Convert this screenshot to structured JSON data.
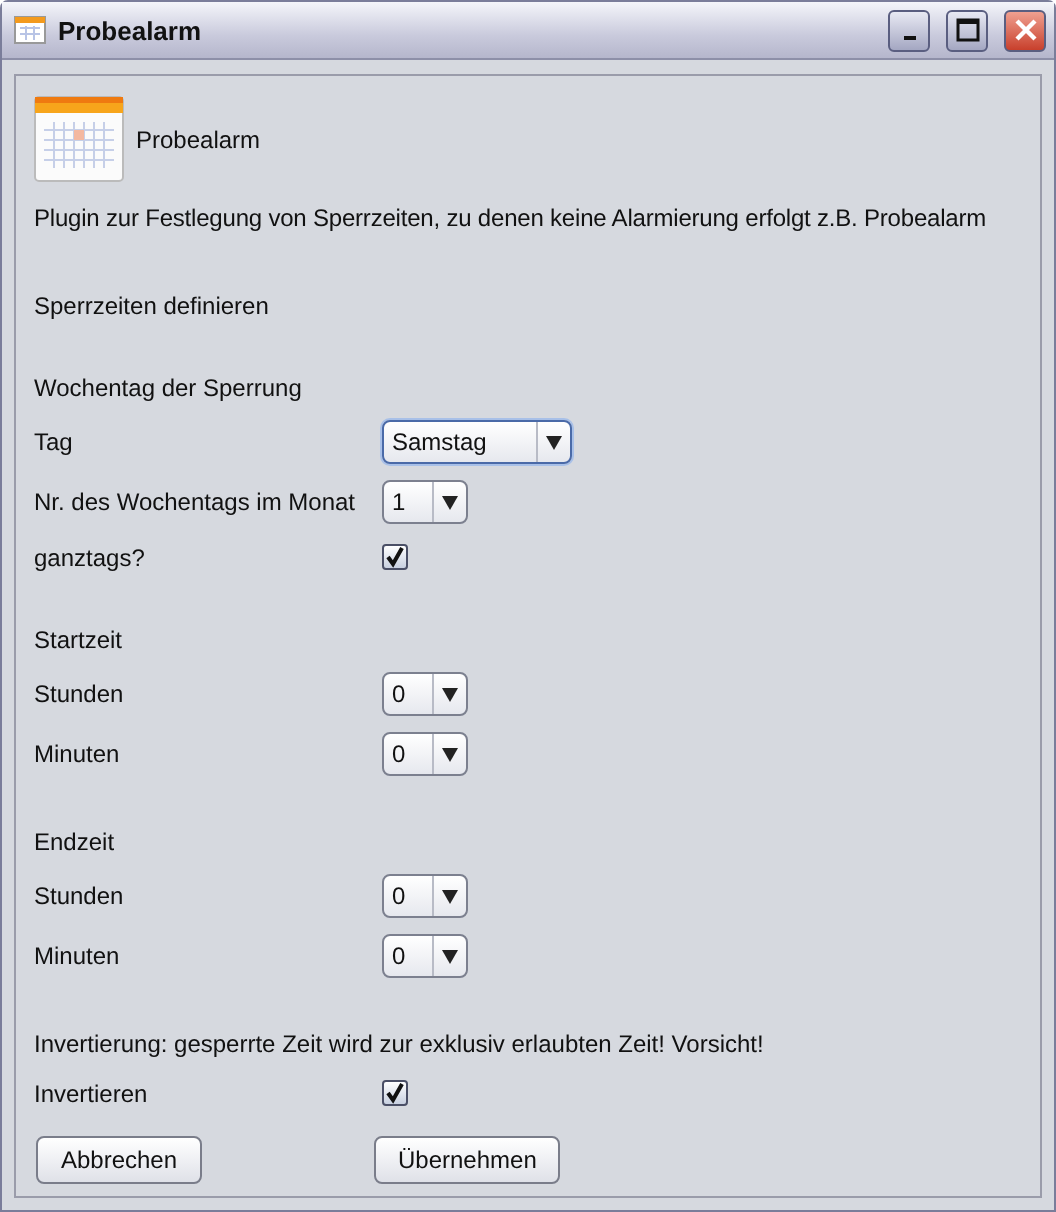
{
  "window": {
    "title": "Probealarm"
  },
  "header": {
    "title": "Probealarm"
  },
  "description": "Plugin zur Festlegung von Sperrzeiten, zu denen keine Alarmierung erfolgt z.B. Probealarm",
  "sections": [
    {
      "rows": [
        {
          "kind": "text",
          "label": "Sperrzeiten definieren"
        }
      ]
    },
    {
      "rows": [
        {
          "kind": "text",
          "label": "Wochentag der Sperrung"
        },
        {
          "kind": "select",
          "label": "Tag",
          "value": "Samstag",
          "focused": true
        },
        {
          "kind": "select",
          "label": "Nr. des Wochentags im Monat",
          "value": "1",
          "focused": false
        },
        {
          "kind": "checkbox",
          "label": "ganztags?",
          "checked": true
        }
      ]
    },
    {
      "rows": [
        {
          "kind": "text",
          "label": "Startzeit"
        },
        {
          "kind": "select",
          "label": "Stunden",
          "value": "0",
          "focused": false
        },
        {
          "kind": "select",
          "label": "Minuten",
          "value": "0",
          "focused": false
        }
      ]
    },
    {
      "rows": [
        {
          "kind": "text",
          "label": "Endzeit"
        },
        {
          "kind": "select",
          "label": "Stunden",
          "value": "0",
          "focused": false
        },
        {
          "kind": "select",
          "label": "Minuten",
          "value": "0",
          "focused": false
        }
      ]
    },
    {
      "rows": [
        {
          "kind": "text",
          "label": "Invertierung: gesperrte Zeit wird zur exklusiv erlaubten Zeit! Vorsicht!"
        },
        {
          "kind": "checkbox",
          "label": "Invertieren",
          "checked": true
        }
      ]
    }
  ],
  "buttons": [
    "Abbrechen",
    "Übernehmen"
  ]
}
